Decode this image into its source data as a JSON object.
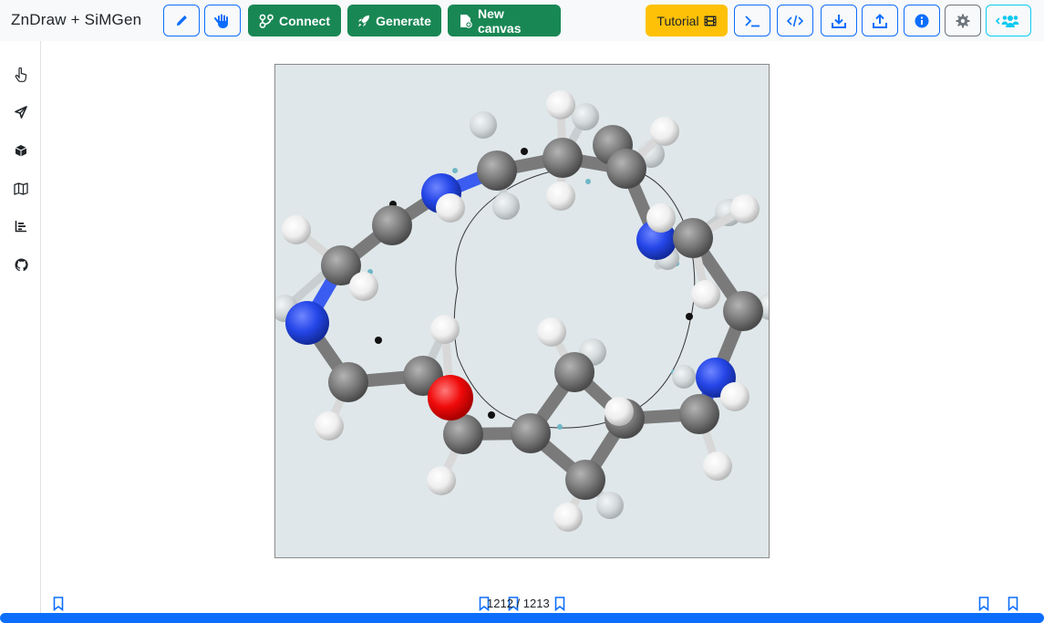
{
  "app": {
    "brand": "ZnDraw + SiMGen"
  },
  "toolbar": {
    "connect_label": "Connect",
    "generate_label": "Generate",
    "new_canvas_label": "New canvas",
    "tutorial_label": "Tutorial",
    "icons": [
      "pencil-icon",
      "hand-paper-icon",
      "connect-icon",
      "rocket-icon",
      "new-file-icon",
      "film-icon",
      "terminal-icon",
      "code-icon",
      "download-icon",
      "upload-icon",
      "info-icon",
      "gear-icon",
      "users-icon"
    ]
  },
  "sidebar": {
    "items": [
      {
        "name": "selection-pointer-icon"
      },
      {
        "name": "send-icon"
      },
      {
        "name": "cube-icon"
      },
      {
        "name": "map-icon"
      },
      {
        "name": "chart-icon"
      },
      {
        "name": "github-icon"
      }
    ]
  },
  "timeline": {
    "current_frame": "1212",
    "separator": "/",
    "total_frames": "1213",
    "progress": 1.0
  },
  "colors": {
    "primary": "#0d6efd",
    "success": "#198754",
    "warning": "#ffc107",
    "info": "#0dcaf0",
    "secondary": "#6c757d",
    "canvas_bg": "#dfe7ea",
    "carbon": "#808080",
    "nitrogen": "#2546e8",
    "oxygen": "#ff0d0d",
    "hydrogen": "#f2f2f2"
  }
}
